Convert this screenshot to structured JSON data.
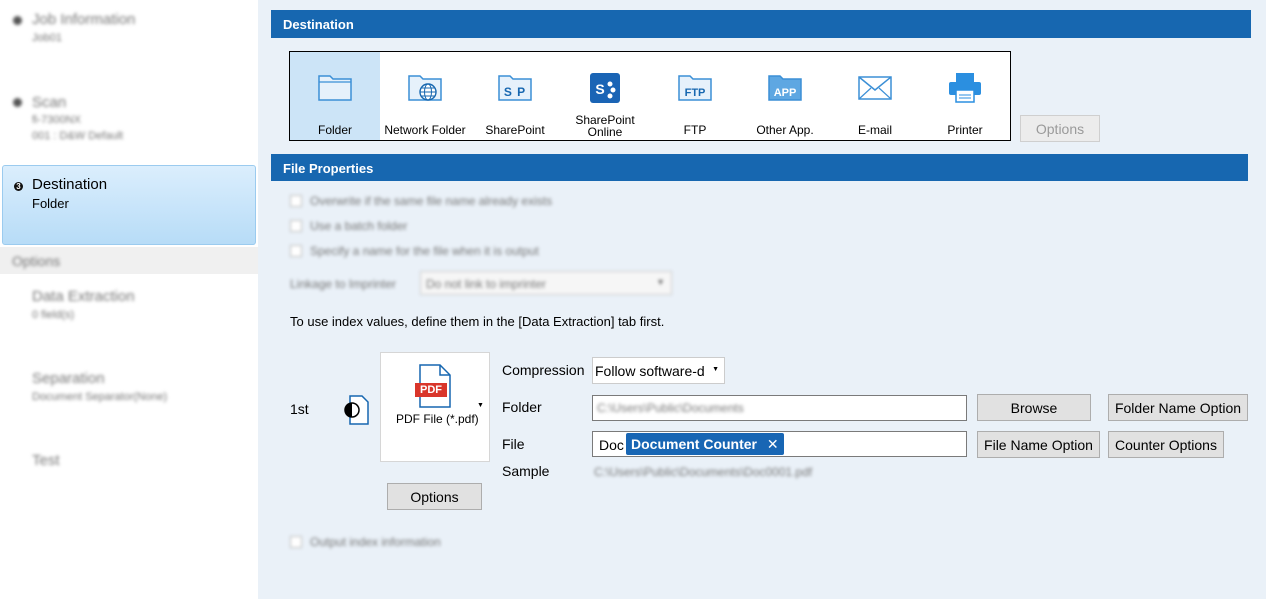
{
  "sidebar": {
    "job": {
      "title": "Job Information",
      "sub": "Job01"
    },
    "scan": {
      "title": "Scan",
      "sub1": "fi-7300NX",
      "sub2": "001 : D&W Default"
    },
    "destination": {
      "num": "3",
      "title": "Destination",
      "sub": "Folder"
    },
    "options_header": "Options",
    "data_extraction": {
      "title": "Data Extraction",
      "sub": "0 field(s)"
    },
    "separation": {
      "title": "Separation",
      "sub": "Document Separator(None)"
    },
    "test": {
      "title": "Test"
    }
  },
  "destination_bar": "Destination",
  "destinations": [
    {
      "label": "Folder",
      "icon": "folder-icon"
    },
    {
      "label": "Network Folder",
      "icon": "network-folder-icon"
    },
    {
      "label": "SharePoint",
      "icon": "sharepoint-icon"
    },
    {
      "label": "SharePoint Online",
      "icon": "sharepoint-online-icon"
    },
    {
      "label": "FTP",
      "icon": "ftp-icon"
    },
    {
      "label": "Other App.",
      "icon": "app-icon"
    },
    {
      "label": "E-mail",
      "icon": "email-icon"
    },
    {
      "label": "Printer",
      "icon": "printer-icon"
    }
  ],
  "dest_options_button": "Options",
  "file_properties_bar": "File Properties",
  "checkboxes": [
    "Overwrite if the same file name already exists",
    "Use a batch folder",
    "Specify a name for the file when it is output"
  ],
  "linkage_label": "Linkage to Imprinter",
  "linkage_value": "Do not link to imprinter",
  "index_note": "To use index values, define them in the [Data Extraction] tab first.",
  "row_label": "1st",
  "file_format": "PDF File (*.pdf)",
  "pdf_badge": "PDF",
  "format_options_button": "Options",
  "compression_label": "Compression",
  "compression_value": "Follow software-d",
  "folder_label": "Folder",
  "folder_value": "C:\\Users\\Public\\Documents",
  "browse_button": "Browse",
  "folder_name_option_button": "Folder Name Option",
  "file_label": "File",
  "file_prefix": "Doc",
  "file_token": "Document Counter",
  "file_name_option_button": "File Name Option",
  "counter_options_button": "Counter Options",
  "sample_label": "Sample",
  "sample_value": "C:\\Users\\Public\\Documents\\Doc0001.pdf",
  "output_index_label": "Output index information",
  "colors": {
    "accent": "#1767b0",
    "selected": "#cce4f7"
  }
}
